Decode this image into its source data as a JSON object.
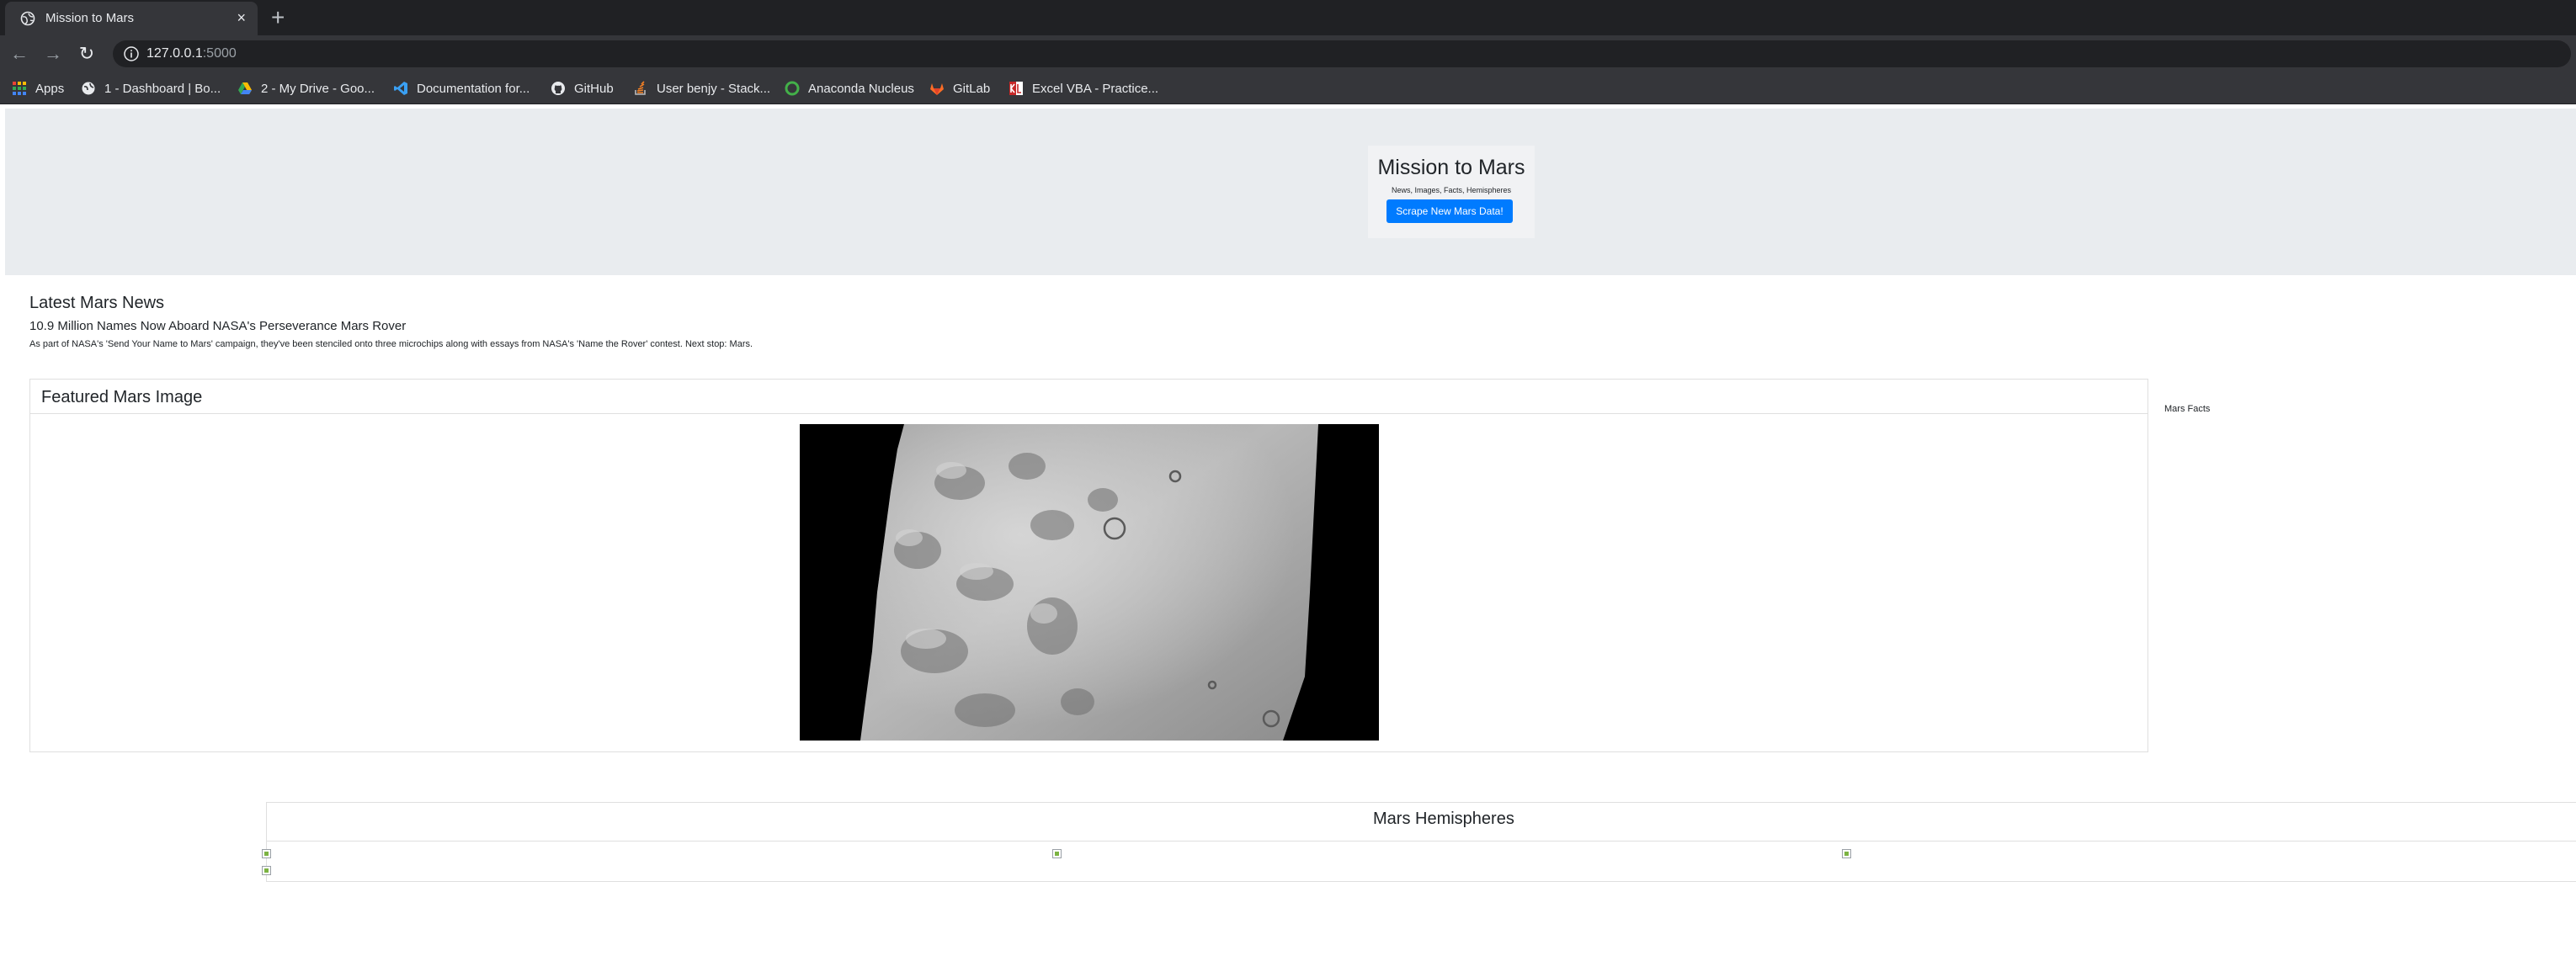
{
  "browser": {
    "tab_title": "Mission to Mars",
    "tab_close": "×",
    "new_tab": "+",
    "url_host": "127.0.0.1",
    "url_port": ":5000",
    "nav": {
      "back": "←",
      "forward": "→",
      "reload": "↻"
    },
    "bookmarks": [
      {
        "label": "Apps",
        "icon": "apps-grid-icon"
      },
      {
        "label": "1 - Dashboard | Bo...",
        "icon": "globe-icon"
      },
      {
        "label": "2 - My Drive - Goo...",
        "icon": "google-drive-icon"
      },
      {
        "label": "Documentation for...",
        "icon": "vscode-icon"
      },
      {
        "label": "GitHub",
        "icon": "github-icon"
      },
      {
        "label": "User benjy - Stack...",
        "icon": "stackoverflow-icon"
      },
      {
        "label": "Anaconda Nucleus",
        "icon": "anaconda-icon"
      },
      {
        "label": "GitLab",
        "icon": "gitlab-icon"
      },
      {
        "label": "Excel VBA - Practice...",
        "icon": "excel-vba-icon"
      }
    ]
  },
  "hero": {
    "title": "Mission to Mars",
    "subtitle": "News, Images, Facts, Hemispheres",
    "button_label": "Scrape New Mars Data!",
    "button_color": "#007bff"
  },
  "news": {
    "heading": "Latest Mars News",
    "title": "10.9 Million Names Now Aboard NASA's Perseverance Mars Rover",
    "teaser": "As part of NASA's 'Send Your Name to Mars' campaign, they've been stenciled onto three microchips along with essays from NASA's 'Name the Rover' contest. Next stop: Mars."
  },
  "featured": {
    "heading": "Featured Mars Image"
  },
  "facts": {
    "label": "Mars Facts"
  },
  "hemispheres": {
    "heading": "Mars Hemispheres"
  }
}
